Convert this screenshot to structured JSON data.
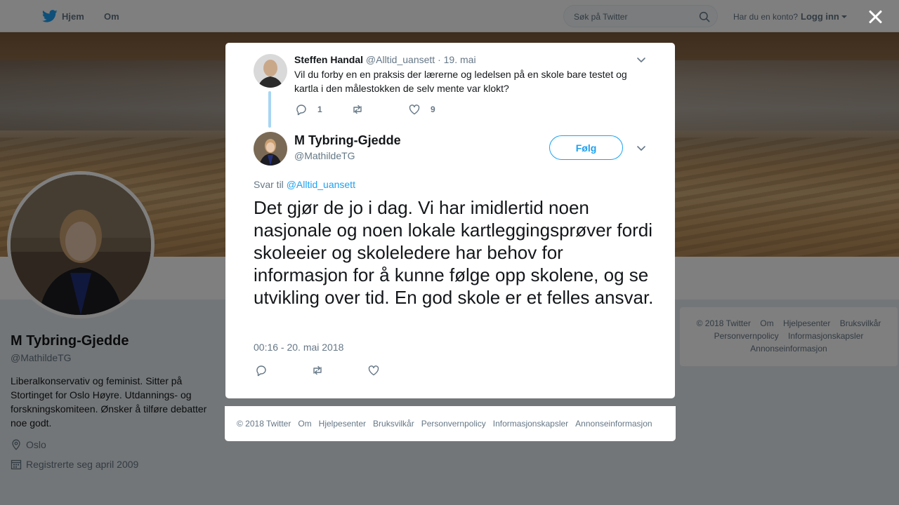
{
  "nav": {
    "home_label": "Hjem",
    "about_label": "Om",
    "search_placeholder": "Søk på Twitter",
    "login_question": "Har du en konto?",
    "login_label": "Logg inn"
  },
  "profile": {
    "name": "M Tybring-Gjedde",
    "handle": "@MathildeTG",
    "bio": "Liberalkonservativ og feminist. Sitter på Stortinget for Oslo Høyre. Utdannings- og forskningskomiteen. Ønsker å tilføre debatter noe godt.",
    "location": "Oslo",
    "joined": "Registrerte seg april 2009"
  },
  "footer_links": [
    "© 2018 Twitter",
    "Om",
    "Hjelpesenter",
    "Bruksvilkår",
    "Personvernpolicy",
    "Informasjonskapsler",
    "Annonseinformasjon"
  ],
  "quoted_tweet": {
    "name": "Steffen Handal",
    "handle": "@Alltid_uansett",
    "separator": "·",
    "date": "19. mai",
    "text": "Vil du forby en en praksis der lærerne og ledelsen på en skole bare testet og kartla i den målestokken de selv mente var klokt?",
    "reply_count": "1",
    "like_count": "9"
  },
  "main_tweet": {
    "name": "M Tybring-Gjedde",
    "handle": "@MathildeTG",
    "follow_label": "Følg",
    "reply_prefix": "Svar til",
    "reply_mention": "@Alltid_uansett",
    "text": "Det gjør de jo i dag. Vi har imidlertid noen nasjonale og noen lokale kartleggingsprøver fordi skoleeier og skoleledere har behov for informasjon for å kunne følge opp skolene, og se utvikling over tid. En god skole er et felles ansvar.",
    "timestamp": "00:16 - 20. mai 2018"
  },
  "colors": {
    "accent": "#1da1f2",
    "muted": "#657786",
    "text": "#14171a"
  }
}
